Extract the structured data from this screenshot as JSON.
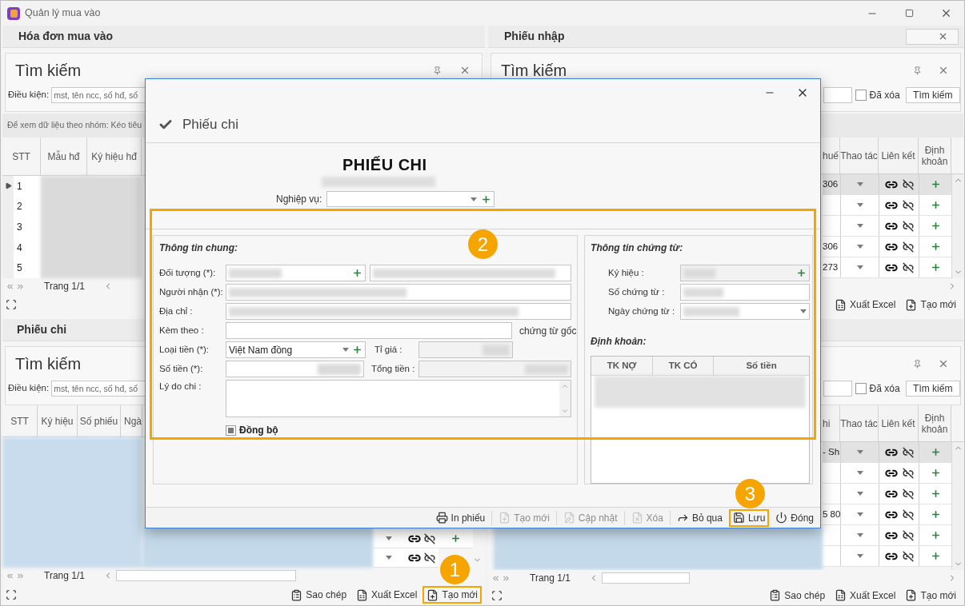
{
  "window": {
    "title": "Quản lý mua vào"
  },
  "invoices_panel": {
    "header": "Hóa đơn mua vào",
    "search": {
      "title": "Tìm kiếm",
      "condition_label": "Điều kiện:",
      "placeholder": "mst, tên ncc, số hđ, số"
    },
    "group_hint": "Để xem dữ liệu theo nhóm: Kéo tiêu",
    "columns": [
      "STT",
      "Mẫu hđ",
      "Ký hiệu hđ"
    ],
    "rows": [
      {
        "stt": "1",
        "selected": true
      },
      {
        "stt": "2",
        "selected": false
      },
      {
        "stt": "3",
        "selected": false
      },
      {
        "stt": "4",
        "selected": false
      },
      {
        "stt": "5",
        "selected": false
      }
    ],
    "pager": "Trang 1/1"
  },
  "receipts_panel": {
    "header": "Phiếu nhập",
    "search": {
      "title": "Tìm kiếm",
      "deleted_label": "Đã xóa",
      "deleted_checked": false,
      "button": "Tìm kiếm"
    },
    "columns": [
      "huế",
      "Thao tác",
      "Liên kết",
      "Định khoản"
    ],
    "rows": [
      {
        "cell": "306",
        "selected": true
      },
      {
        "selected": false
      },
      {
        "selected": false
      },
      {
        "cell": "306",
        "selected": false
      },
      {
        "cell": "273",
        "selected": false
      }
    ],
    "toolbar": [
      {
        "label": "Xuất Excel",
        "highlighted": false
      },
      {
        "label": "Tạo mới",
        "highlighted": false
      }
    ]
  },
  "payments_panel": {
    "header": "Phiếu chi",
    "search": {
      "title": "Tìm kiếm",
      "condition_label": "Điều kiện:",
      "placeholder": "mst, tên ncc, số hđ, số"
    },
    "columns": [
      "STT",
      "Ký hiệu",
      "Số phiếu",
      "Ngà"
    ],
    "rows": [
      {
        "selected": false
      },
      {
        "selected": false
      }
    ],
    "pager": "Trang 1/1",
    "toolbar": [
      {
        "label": "Sao chép",
        "highlighted": false
      },
      {
        "label": "Xuất Excel",
        "highlighted": false
      },
      {
        "label": "Tạo mới",
        "highlighted": true
      }
    ]
  },
  "fourth_panel": {
    "search": {
      "deleted_label": "Đã xóa",
      "deleted_checked": false,
      "button": "Tìm kiếm"
    },
    "columns": [
      "hi",
      "Thao tác",
      "Liên kết",
      "Định khoản"
    ],
    "rows": [
      {
        "cell": "- Sh",
        "selected": true
      },
      {
        "selected": false
      },
      {
        "selected": false
      },
      {
        "cell": "5 80",
        "selected": false
      },
      {
        "selected": false
      },
      {
        "selected": false
      }
    ],
    "pager": "Trang 1/1",
    "toolbar": [
      {
        "label": "Sao chép",
        "highlighted": false
      },
      {
        "label": "Xuất Excel",
        "highlighted": false
      },
      {
        "label": "Tạo mới",
        "highlighted": false
      }
    ]
  },
  "dialog": {
    "title": "Phiếu chi",
    "heading": "PHIẾU CHI",
    "business_label": "Nghiệp vụ:",
    "general": {
      "title": "Thông tin chung:",
      "object_label": "Đối tượng (*):",
      "recipient_label": "Người nhận (*):",
      "address_label": "Địa chỉ :",
      "attach_label": "Kèm theo :",
      "attach_suffix": "chứng từ gốc",
      "currency_label": "Loại tiền (*):",
      "currency_value": "Việt Nam đồng",
      "rate_label": "Tỉ giá :",
      "amount_label": "Số tiền (*):",
      "total_label": "Tổng tiền :",
      "reason_label": "Lý do chi :",
      "sync_label": "Đồng bộ",
      "sync_indeterminate": true
    },
    "document": {
      "title": "Thông tin chứng từ:",
      "symbol_label": "Ký hiệu :",
      "number_label": "Số chứng từ :",
      "date_label": "Ngày chứng từ :",
      "accounting_title": "Định khoản:",
      "accounting_columns": [
        "TK NỢ",
        "TK CÓ",
        "Số tiền"
      ]
    },
    "toolbar": [
      {
        "label": "In phiếu",
        "disabled": false,
        "highlighted": false
      },
      {
        "label": "Tạo mới",
        "disabled": true,
        "highlighted": false
      },
      {
        "label": "Cập nhật",
        "disabled": true,
        "highlighted": false
      },
      {
        "label": "Xóa",
        "disabled": true,
        "highlighted": false
      },
      {
        "label": "Bỏ qua",
        "disabled": false,
        "highlighted": false
      },
      {
        "label": "Lưu",
        "disabled": false,
        "highlighted": true
      },
      {
        "label": "Đóng",
        "disabled": false,
        "highlighted": false
      }
    ]
  },
  "callouts": [
    "1",
    "2",
    "3"
  ]
}
